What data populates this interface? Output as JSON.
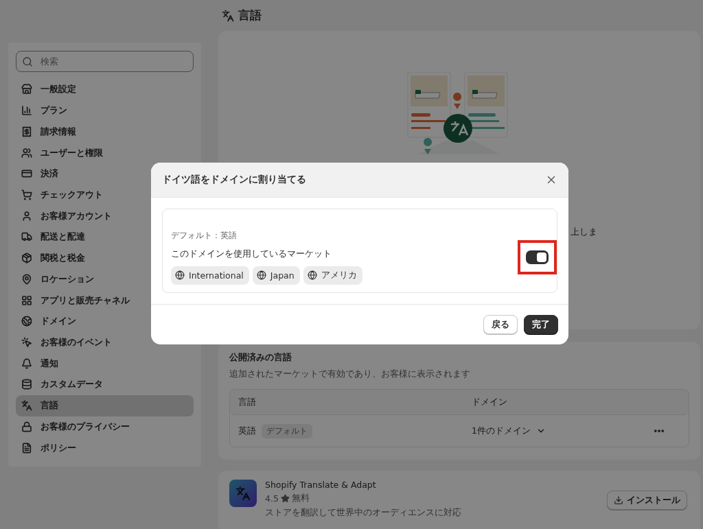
{
  "page": {
    "title": "言語"
  },
  "sidebar": {
    "search": {
      "placeholder": "検索"
    },
    "items": [
      {
        "label": "一般設定",
        "selected": false
      },
      {
        "label": "プラン",
        "selected": false
      },
      {
        "label": "請求情報",
        "selected": false
      },
      {
        "label": "ユーザーと権限",
        "selected": false
      },
      {
        "label": "決済",
        "selected": false
      },
      {
        "label": "チェックアウト",
        "selected": false
      },
      {
        "label": "お客様アカウント",
        "selected": false
      },
      {
        "label": "配送と配達",
        "selected": false
      },
      {
        "label": "関税と税金",
        "selected": false
      },
      {
        "label": "ロケーション",
        "selected": false
      },
      {
        "label": "アプリと販売チャネル",
        "selected": false
      },
      {
        "label": "ドメイン",
        "selected": false
      },
      {
        "label": "お客様のイベント",
        "selected": false
      },
      {
        "label": "通知",
        "selected": false
      },
      {
        "label": "カスタムデータ",
        "selected": false
      },
      {
        "label": "言語",
        "selected": true
      },
      {
        "label": "お客様のプライバシー",
        "selected": false
      },
      {
        "label": "ポリシー",
        "selected": false
      }
    ]
  },
  "hero": {
    "text_fragment": "上しま"
  },
  "published": {
    "title": "公開済みの言語",
    "subtitle": "追加されたマーケットで有効であり、お客様に表示されます",
    "columns": [
      "言語",
      "ドメイン"
    ],
    "rows": [
      {
        "language": "英語",
        "badge": "デフォルト",
        "domains": "1件のドメイン"
      }
    ]
  },
  "app": {
    "name": "Shopify Translate & Adapt",
    "rating": "4.5",
    "price": "無料",
    "description": "ストアを翻訳して世界中のオーディエンスに対応",
    "install": "インストール"
  },
  "modal": {
    "title": "ドイツ語をドメインに割り当てる",
    "default_label": "デフォルト：英語",
    "markets_label": "このドメインを使用しているマーケット",
    "markets": [
      "International",
      "Japan",
      "アメリカ"
    ],
    "toggle": {
      "on": true,
      "highlighted": true
    },
    "buttons": [
      {
        "label": "戻る",
        "kind": "secondary"
      },
      {
        "label": "完了",
        "kind": "primary"
      }
    ]
  }
}
